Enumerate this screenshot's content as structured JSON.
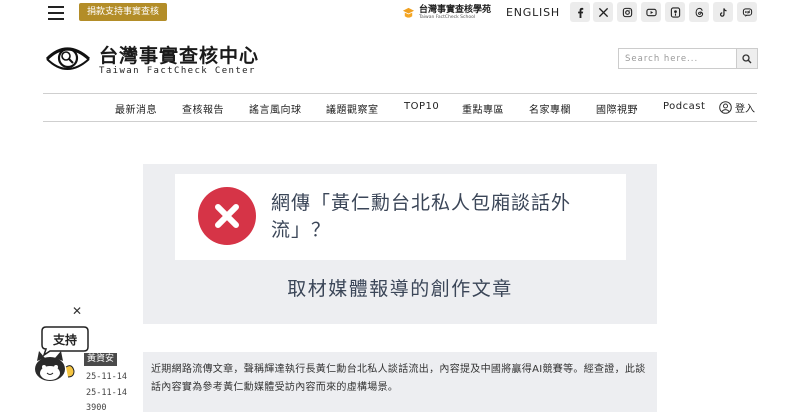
{
  "topbar": {
    "donate_label": "捐款支持事實查核",
    "school_name": "台灣事實查核學苑",
    "school_en": "Taiwan FactCheck School",
    "english_label": "ENGLISH",
    "social_icons": [
      "facebook-icon",
      "x-icon",
      "instagram-icon",
      "youtube-icon",
      "podcast-icon",
      "threads-icon",
      "tiktok-icon",
      "line-icon"
    ]
  },
  "header": {
    "logo_zh": "台灣事實查核中心",
    "logo_en": "Taiwan FactCheck Center",
    "search_placeholder": "Search here..."
  },
  "nav": {
    "items": [
      "最新消息",
      "查核報告",
      "謠言風向球",
      "議題觀察室",
      "TOP10",
      "重點專區",
      "名家專欄",
      "國際視野",
      "Podcast"
    ],
    "login_label": "登入"
  },
  "article": {
    "title": "網傳「黃仁勳台北私人包廂談話外流」？",
    "verdict": "取材媒體報導的創作文章",
    "verdict_color": "#d63447",
    "summary": "近期網路流傳文章，聲稱輝達執行長黃仁勳台北私人談話流出，內容提及中國將贏得AI競賽等。經查證，此談話內容實為參考黃仁勳媒體受訪內容而來的虛構場景。"
  },
  "side_widget": {
    "mascot_text": "支持",
    "author_tag": "黃資安",
    "meta_lines": [
      "25-11-14",
      "25-11-14",
      "3900"
    ]
  }
}
